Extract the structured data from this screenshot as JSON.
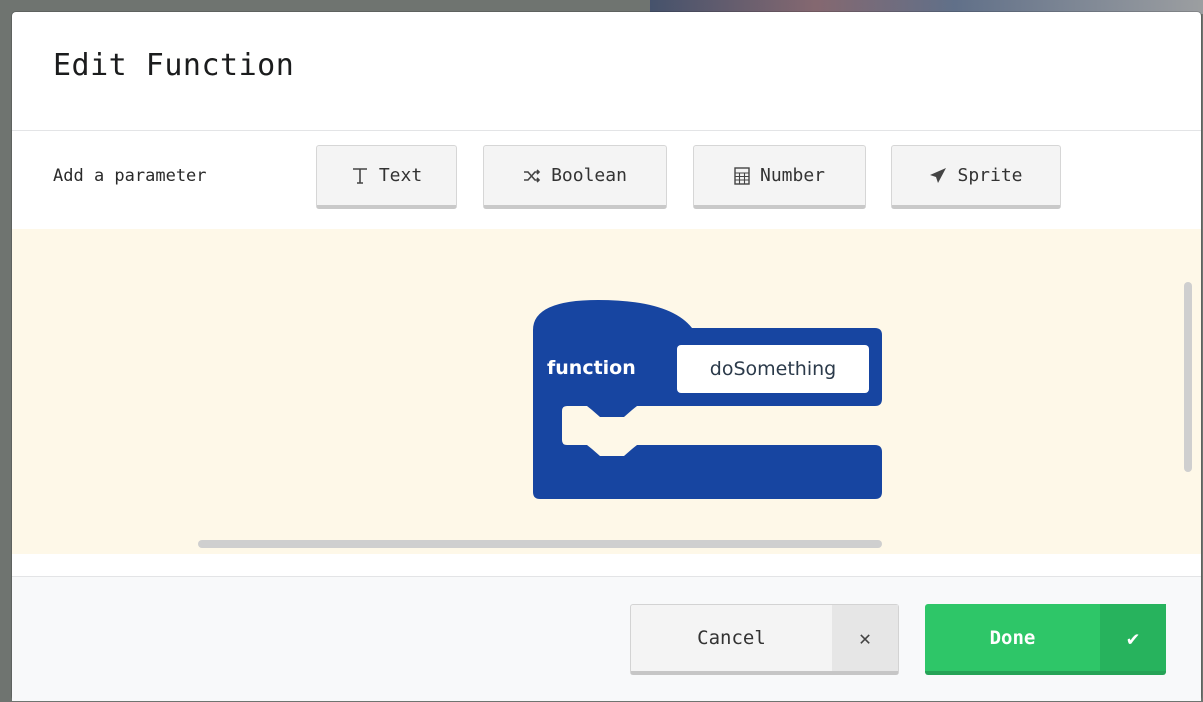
{
  "dialog": {
    "title": "Edit Function"
  },
  "parameters": {
    "label": "Add a parameter",
    "buttons": [
      {
        "label": "Text",
        "icon": "text-cursor-icon"
      },
      {
        "label": "Boolean",
        "icon": "shuffle-icon"
      },
      {
        "label": "Number",
        "icon": "calculator-icon"
      },
      {
        "label": "Sprite",
        "icon": "paper-plane-icon"
      }
    ]
  },
  "block": {
    "keyword": "function",
    "name": "doSomething",
    "color": "#1745a1"
  },
  "footer": {
    "cancel_label": "Cancel",
    "cancel_icon": "close-icon",
    "done_label": "Done",
    "done_icon": "check-icon",
    "done_color": "#2ec668"
  }
}
